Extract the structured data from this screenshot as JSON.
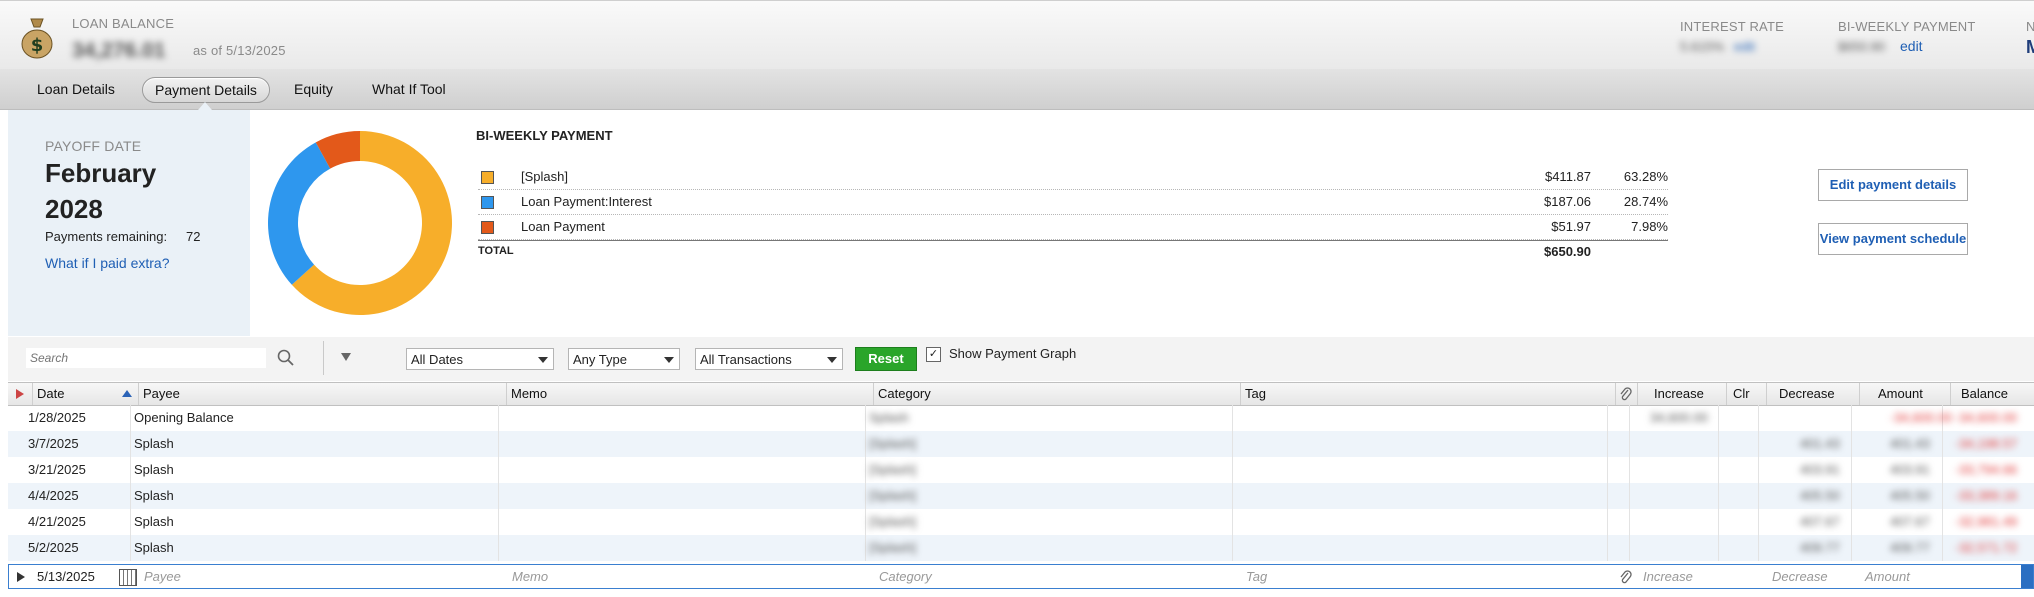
{
  "header": {
    "loan_balance_label": "LOAN BALANCE",
    "loan_balance_value": "34,276.01",
    "as_of": "as of 5/13/2025",
    "interest_rate_label": "INTEREST RATE",
    "interest_rate_value": "5.615%",
    "interest_rate_edit": "edit",
    "payment_label": "BI-WEEKLY PAYMENT",
    "payment_value": "$650.90",
    "payment_edit": "edit",
    "cut_label": "N",
    "cut_value": "M"
  },
  "tabs": [
    "Loan Details",
    "Payment Details",
    "Equity",
    "What If Tool"
  ],
  "active_tab": "Payment Details",
  "payoff": {
    "label": "PAYOFF DATE",
    "month": "February",
    "year": "2028",
    "remaining_label": "Payments remaining:",
    "remaining_value": "72",
    "what_if_link": "What if I paid extra?"
  },
  "payment_breakdown": {
    "title": "BI-WEEKLY PAYMENT",
    "rows": [
      {
        "name": "[Splash]",
        "amount": "$411.87",
        "percent": "63.28%",
        "color": "#f7ae2a",
        "fraction": 0.6328
      },
      {
        "name": "Loan Payment:Interest",
        "amount": "$187.06",
        "percent": "28.74%",
        "color": "#2e97ee",
        "fraction": 0.2874
      },
      {
        "name": "Loan Payment",
        "amount": "$51.97",
        "percent": "7.98%",
        "color": "#e3591a",
        "fraction": 0.0798
      }
    ],
    "total_label": "TOTAL",
    "total_value": "$650.90"
  },
  "buttons": {
    "edit_payment": "Edit payment details",
    "view_schedule": "View payment schedule"
  },
  "filters": {
    "search_placeholder": "Search",
    "dates": "All Dates",
    "type": "Any Type",
    "transactions": "All Transactions",
    "reset": "Reset",
    "show_graph_label": "Show Payment Graph",
    "show_graph_checked": true
  },
  "grid": {
    "columns": [
      "Date",
      "Payee",
      "Memo",
      "Category",
      "Tag",
      "Increase",
      "Clr",
      "Decrease",
      "Amount",
      "Balance"
    ],
    "rows": [
      {
        "date": "1/28/2025",
        "payee": "Opening Balance",
        "category": "Splash",
        "increase": "34,600.00",
        "decrease": "",
        "amount": "-34,600.00",
        "balance": "-34,600.00"
      },
      {
        "date": "3/7/2025",
        "payee": "Splash",
        "category": "[Splash]",
        "increase": "",
        "decrease": "401.43",
        "amount": "401.43",
        "balance": "-34,198.57"
      },
      {
        "date": "3/21/2025",
        "payee": "Splash",
        "category": "[Splash]",
        "increase": "",
        "decrease": "403.91",
        "amount": "403.91",
        "balance": "-33,794.66"
      },
      {
        "date": "4/4/2025",
        "payee": "Splash",
        "category": "[Splash]",
        "increase": "",
        "decrease": "405.50",
        "amount": "405.50",
        "balance": "-33,389.16"
      },
      {
        "date": "4/21/2025",
        "payee": "Splash",
        "category": "[Splash]",
        "increase": "",
        "decrease": "407.67",
        "amount": "407.67",
        "balance": "-32,981.49"
      },
      {
        "date": "5/2/2025",
        "payee": "Splash",
        "category": "[Splash]",
        "increase": "",
        "decrease": "409.77",
        "amount": "409.77",
        "balance": "-32,571.72"
      }
    ],
    "entry": {
      "date": "5/13/2025",
      "payee_placeholder": "Payee",
      "memo_placeholder": "Memo",
      "category_placeholder": "Category",
      "tag_placeholder": "Tag",
      "increase_placeholder": "Increase",
      "decrease_placeholder": "Decrease",
      "amount_placeholder": "Amount"
    }
  }
}
